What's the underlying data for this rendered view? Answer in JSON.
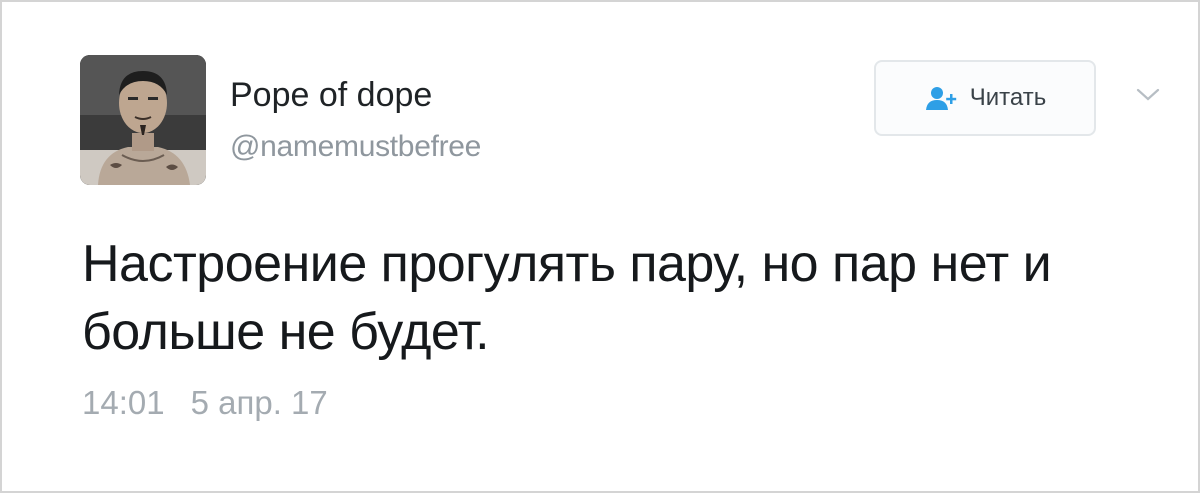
{
  "tweet": {
    "author": {
      "display_name": "Pope of dope",
      "username": "@namemustbefree",
      "avatar_icon": "user-avatar-photo"
    },
    "follow_button": {
      "label": "Читать",
      "icon": "add-user-icon",
      "icon_color": "#2e9fe6"
    },
    "menu_icon": "chevron-down-icon",
    "text": "Настроение прогулять пару, но пар нет и больше не будет.",
    "time": "14:01",
    "date": "5 апр. 17"
  }
}
